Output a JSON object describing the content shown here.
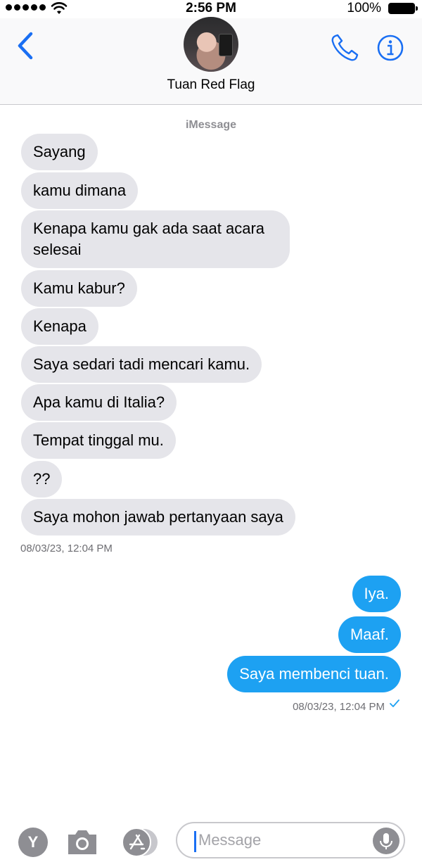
{
  "status_bar": {
    "time": "2:56 PM",
    "battery": "100%"
  },
  "header": {
    "contact_name": "Tuan Red Flag"
  },
  "conversation": {
    "service": "iMessage",
    "incoming": [
      "Sayang",
      "kamu dimana",
      "Kenapa kamu gak ada saat acara",
      "selesai",
      "Kamu kabur?",
      "Kenapa",
      "Saya sedari tadi mencari kamu.",
      "Apa kamu di Italia?",
      "Tempat tinggal mu.",
      "??",
      "Saya mohon jawab pertanyaan saya"
    ],
    "incoming_timestamp": "08/03/23, 12:04 PM",
    "outgoing": [
      "Iya.",
      "Maaf.",
      "Saya membenci tuan."
    ],
    "outgoing_timestamp": "08/03/23, 12:04 PM"
  },
  "composer": {
    "app_letter": "Y",
    "placeholder": "Message"
  },
  "colors": {
    "accent": "#1a6ff3",
    "outgoing_bubble": "#1da1f2",
    "incoming_bubble": "#e5e5ea"
  }
}
